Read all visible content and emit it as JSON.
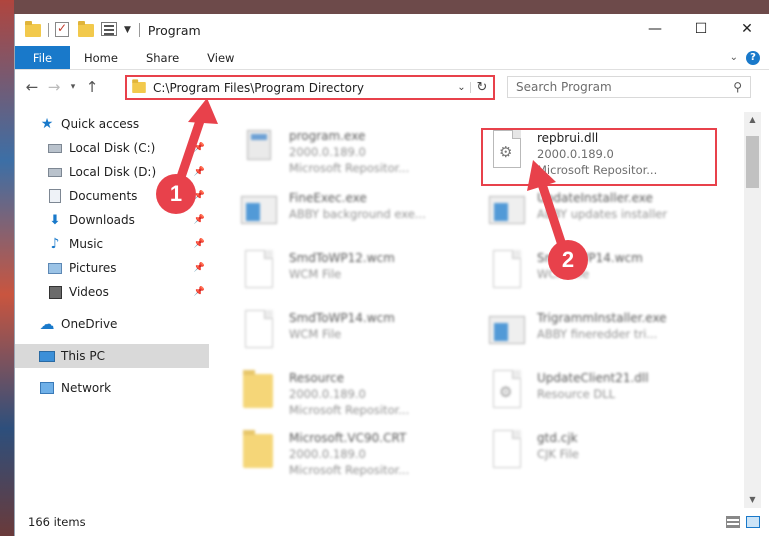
{
  "window": {
    "title": "Program"
  },
  "ribbon": {
    "tabs": [
      "File",
      "Home",
      "Share",
      "View"
    ]
  },
  "address": {
    "path": "C:\\Program Files\\Program Directory"
  },
  "search": {
    "placeholder": "Search Program"
  },
  "sidebar": {
    "items": [
      {
        "label": "Quick access",
        "icon": "star-icon"
      },
      {
        "label": "Local Disk (C:)",
        "icon": "disk-icon"
      },
      {
        "label": "Local Disk (D:)",
        "icon": "disk-icon"
      },
      {
        "label": "Documents",
        "icon": "documents-icon"
      },
      {
        "label": "Downloads",
        "icon": "download-icon"
      },
      {
        "label": "Music",
        "icon": "music-icon"
      },
      {
        "label": "Pictures",
        "icon": "pictures-icon"
      },
      {
        "label": "Videos",
        "icon": "videos-icon"
      },
      {
        "label": "OneDrive",
        "icon": "cloud-icon"
      },
      {
        "label": "This PC",
        "icon": "computer-icon"
      },
      {
        "label": "Network",
        "icon": "network-icon"
      }
    ]
  },
  "files": [
    {
      "name": "program.exe",
      "line1": "2000.0.189.0",
      "line2": "Microsoft Repositor...",
      "icon": "exe-icon"
    },
    {
      "name": "repbrui.dll",
      "line1": "2000.0.189.0",
      "line2": "Microsoft Repositor...",
      "icon": "gear-file-icon"
    },
    {
      "name": "FineExec.exe",
      "line1": "ABBY background exe...",
      "line2": "",
      "icon": "app-icon"
    },
    {
      "name": "UpdateInstaller.exe",
      "line1": "ABBY updates installer",
      "line2": "",
      "icon": "app-icon"
    },
    {
      "name": "SmdToWP12.wcm",
      "line1": "WCM File",
      "line2": "",
      "icon": "blank-file-icon"
    },
    {
      "name": "SmdToWP14.wcm",
      "line1": "WCM File",
      "line2": "",
      "icon": "blank-file-icon"
    },
    {
      "name": "SmdToWP14.wcm",
      "line1": "WCM File",
      "line2": "",
      "icon": "blank-file-icon"
    },
    {
      "name": "TrigrammInstaller.exe",
      "line1": "ABBY fineredder tri...",
      "line2": "",
      "icon": "app-icon"
    },
    {
      "name": "Resource",
      "line1": "2000.0.189.0",
      "line2": "Microsoft Repositor...",
      "icon": "folder-icon"
    },
    {
      "name": "UpdateClient21.dll",
      "line1": "Resource DLL",
      "line2": "",
      "icon": "gear-file-icon"
    },
    {
      "name": "Microsoft.VC90.CRT",
      "line1": "2000.0.189.0",
      "line2": "Microsoft Repositor...",
      "icon": "folder-icon"
    },
    {
      "name": "gtd.cjk",
      "line1": "CJK File",
      "line2": "",
      "icon": "blank-file-icon"
    }
  ],
  "status": {
    "item_count": "166 items"
  },
  "annotations": {
    "step1": "1",
    "step2": "2",
    "color": "#e8414b"
  }
}
